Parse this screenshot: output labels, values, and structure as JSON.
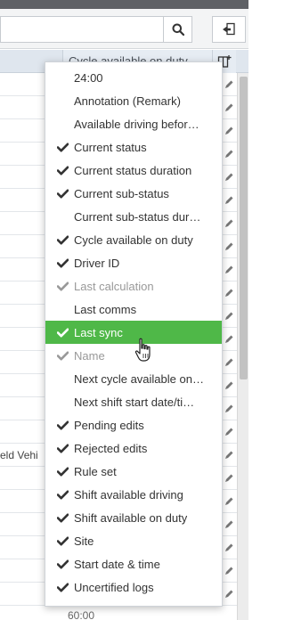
{
  "toolbar": {
    "search_placeholder": ""
  },
  "table": {
    "header_right_label": "Cycle available on duty",
    "partial_cell_text": "eld Vehi",
    "footer_value": "60:00"
  },
  "column_menu": {
    "items": [
      {
        "label": "24:00",
        "checked": false,
        "disabled": false,
        "selected": false
      },
      {
        "label": "Annotation (Remark)",
        "checked": false,
        "disabled": false,
        "selected": false
      },
      {
        "label": "Available driving befor…",
        "checked": false,
        "disabled": false,
        "selected": false
      },
      {
        "label": "Current status",
        "checked": true,
        "disabled": false,
        "selected": false
      },
      {
        "label": "Current status duration",
        "checked": true,
        "disabled": false,
        "selected": false
      },
      {
        "label": "Current sub-status",
        "checked": true,
        "disabled": false,
        "selected": false
      },
      {
        "label": "Current sub-status dur…",
        "checked": false,
        "disabled": false,
        "selected": false
      },
      {
        "label": "Cycle available on duty",
        "checked": true,
        "disabled": false,
        "selected": false
      },
      {
        "label": "Driver ID",
        "checked": true,
        "disabled": false,
        "selected": false
      },
      {
        "label": "Last calculation",
        "checked": true,
        "disabled": true,
        "selected": false
      },
      {
        "label": "Last comms",
        "checked": false,
        "disabled": false,
        "selected": false
      },
      {
        "label": "Last sync",
        "checked": true,
        "disabled": false,
        "selected": true
      },
      {
        "label": "Name",
        "checked": true,
        "disabled": true,
        "selected": false
      },
      {
        "label": "Next cycle available on…",
        "checked": false,
        "disabled": false,
        "selected": false
      },
      {
        "label": "Next shift start date/ti…",
        "checked": false,
        "disabled": false,
        "selected": false
      },
      {
        "label": "Pending edits",
        "checked": true,
        "disabled": false,
        "selected": false
      },
      {
        "label": "Rejected edits",
        "checked": true,
        "disabled": false,
        "selected": false
      },
      {
        "label": "Rule set",
        "checked": true,
        "disabled": false,
        "selected": false
      },
      {
        "label": "Shift available driving",
        "checked": true,
        "disabled": false,
        "selected": false
      },
      {
        "label": "Shift available on duty",
        "checked": true,
        "disabled": false,
        "selected": false
      },
      {
        "label": "Site",
        "checked": true,
        "disabled": false,
        "selected": false
      },
      {
        "label": "Start date & time",
        "checked": true,
        "disabled": false,
        "selected": false
      },
      {
        "label": "Uncertified logs",
        "checked": true,
        "disabled": false,
        "selected": false
      }
    ]
  },
  "colors": {
    "selected_bg": "#4fb848",
    "check_color": "#333333",
    "disabled_check": "#999999"
  }
}
